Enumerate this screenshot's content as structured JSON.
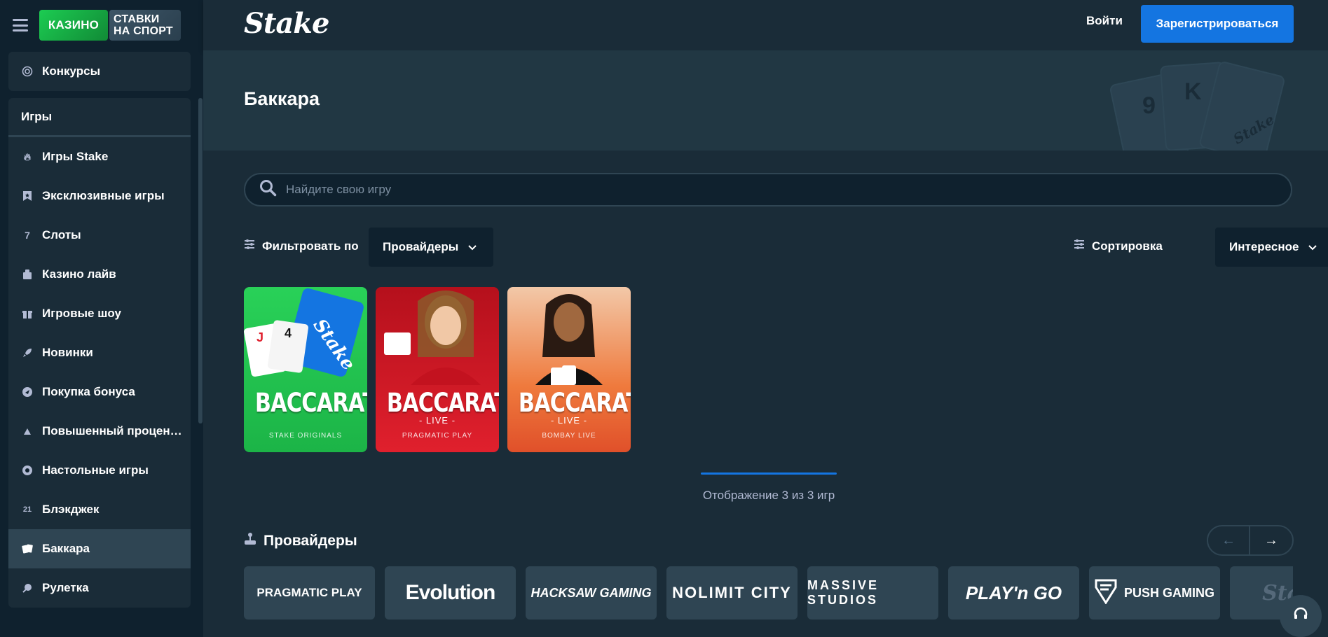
{
  "tabs": {
    "casino": "КАЗИНО",
    "sport_line1": "СТАВКИ",
    "sport_line2": "НА СПОРТ"
  },
  "header": {
    "logo": "Stake",
    "login": "Войти",
    "register": "Зарегистрироваться"
  },
  "sidebar": {
    "top_item": {
      "label": "Конкурсы",
      "icon": "target-icon"
    },
    "section_title": "Игры",
    "items": [
      {
        "label": "Игры Stake",
        "icon": "fire-icon"
      },
      {
        "label": "Эксклюзивные игры",
        "icon": "bookmark-star-icon"
      },
      {
        "label": "Слоты",
        "icon": "slots-icon"
      },
      {
        "label": "Казино лайв",
        "icon": "dealer-icon"
      },
      {
        "label": "Игровые шоу",
        "icon": "gift-icon"
      },
      {
        "label": "Новинки",
        "icon": "rocket-icon"
      },
      {
        "label": "Покупка бонуса",
        "icon": "bonus-icon"
      },
      {
        "label": "Повышенный процен…",
        "icon": "rtp-icon"
      },
      {
        "label": "Настольные игры",
        "icon": "chip-icon"
      },
      {
        "label": "Блэкджек",
        "icon": "blackjack-icon"
      },
      {
        "label": "Баккара",
        "icon": "cards-icon",
        "active": true
      },
      {
        "label": "Рулетка",
        "icon": "roulette-icon"
      }
    ]
  },
  "hero": {
    "title": "Баккара",
    "deco_cards": [
      "9",
      "K",
      "Stake"
    ]
  },
  "search": {
    "placeholder": "Найдите свою игру"
  },
  "filter": {
    "label": "Фильтровать по",
    "dropdown": "Провайдеры"
  },
  "sort": {
    "label": "Сортировка",
    "dropdown": "Интересное"
  },
  "games": [
    {
      "title": "BACCARAT",
      "sub": "",
      "provider": "STAKE ORIGINALS"
    },
    {
      "title": "BACCARAT",
      "sub": "- LIVE -",
      "provider": "PRAGMATIC PLAY"
    },
    {
      "title": "BACCARAT",
      "sub": "- LIVE -",
      "provider": "BOMBAY LIVE"
    }
  ],
  "pagination": {
    "text": "Отображение 3 из 3 игр",
    "progress_fraction": 1.0
  },
  "providers": {
    "title": "Провайдеры",
    "prev": "←",
    "next": "→",
    "items": [
      "PRAGMATIC PLAY",
      "Evolution",
      "HACKSAW GAMING",
      "NOLIMIT CITY",
      "MASSIVE STUDIOS",
      "PLAY'n GO",
      "PUSH GAMING",
      "Stake"
    ]
  },
  "colors": {
    "bg": "#1a2c38",
    "sidebar": "#0f212e",
    "accent_blue": "#1475e1",
    "casino_green": "#1ccc52",
    "panel": "#2f4553"
  }
}
